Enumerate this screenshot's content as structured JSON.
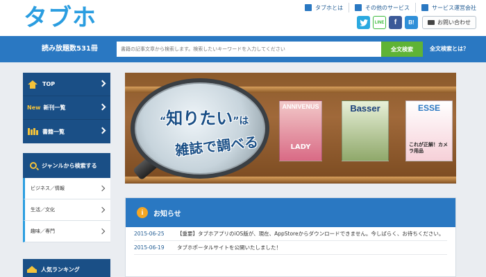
{
  "header": {
    "logo": "タブホ",
    "top_links": [
      {
        "label": "タブホとは",
        "icon": "tablet-icon"
      },
      {
        "label": "その他のサービス",
        "icon": "monitor-icon"
      },
      {
        "label": "サービス運営会社",
        "icon": "building-icon"
      }
    ],
    "social": [
      {
        "label": "",
        "icon": "twitter-icon"
      },
      {
        "label": "LINE",
        "icon": "line-icon"
      },
      {
        "label": "f",
        "icon": "facebook-icon"
      },
      {
        "label": "B!",
        "icon": "hatena-bookmark-icon"
      }
    ],
    "contact_label": "お問い合わせ"
  },
  "search": {
    "count_label": "読み放題数531冊",
    "placeholder": "書籍の記事文章から検索します。検索したいキーワードを入力してください",
    "button_label": "全文検索",
    "help_label": "全文検索とは？"
  },
  "sidebar": {
    "main_items": [
      {
        "label": "TOP",
        "icon": "home-icon",
        "badge": ""
      },
      {
        "label": "新刊一覧",
        "icon": "new-icon",
        "badge": "New"
      },
      {
        "label": "書籍一覧",
        "icon": "books-icon",
        "badge": ""
      }
    ],
    "genre_heading": "ジャンルから検索する",
    "genres": [
      "ビジネス／情報",
      "生活／文化",
      "趣味／専門"
    ],
    "ranking_heading": "人気ランキング"
  },
  "banner": {
    "headline_quote_open": "“",
    "headline_main": "知りたい",
    "headline_quote_close": "”",
    "headline_suffix": "は",
    "headline_line2": "雑誌で調べる",
    "magazines": [
      "ANNIVENUS",
      "Basser",
      "ESSE"
    ],
    "magazine_subtexts": [
      "LADY",
      "これが正解！カメラ用品"
    ]
  },
  "notices": {
    "heading": "お知らせ",
    "items": [
      {
        "date": "2015-06-25",
        "text": "【重要】タブホアプリのiOS版が、現在、AppStoreからダウンロードできません。今しばらく、お待ちください。"
      },
      {
        "date": "2015-06-19",
        "text": "タブホポータルサイトを公開いたしました！"
      }
    ]
  },
  "colors": {
    "brand_blue": "#2a78c2",
    "nav_navy": "#1a4f86",
    "logo_blue": "#2a9de0",
    "search_green": "#5fb335",
    "accent_yellow": "#f5c33a"
  }
}
